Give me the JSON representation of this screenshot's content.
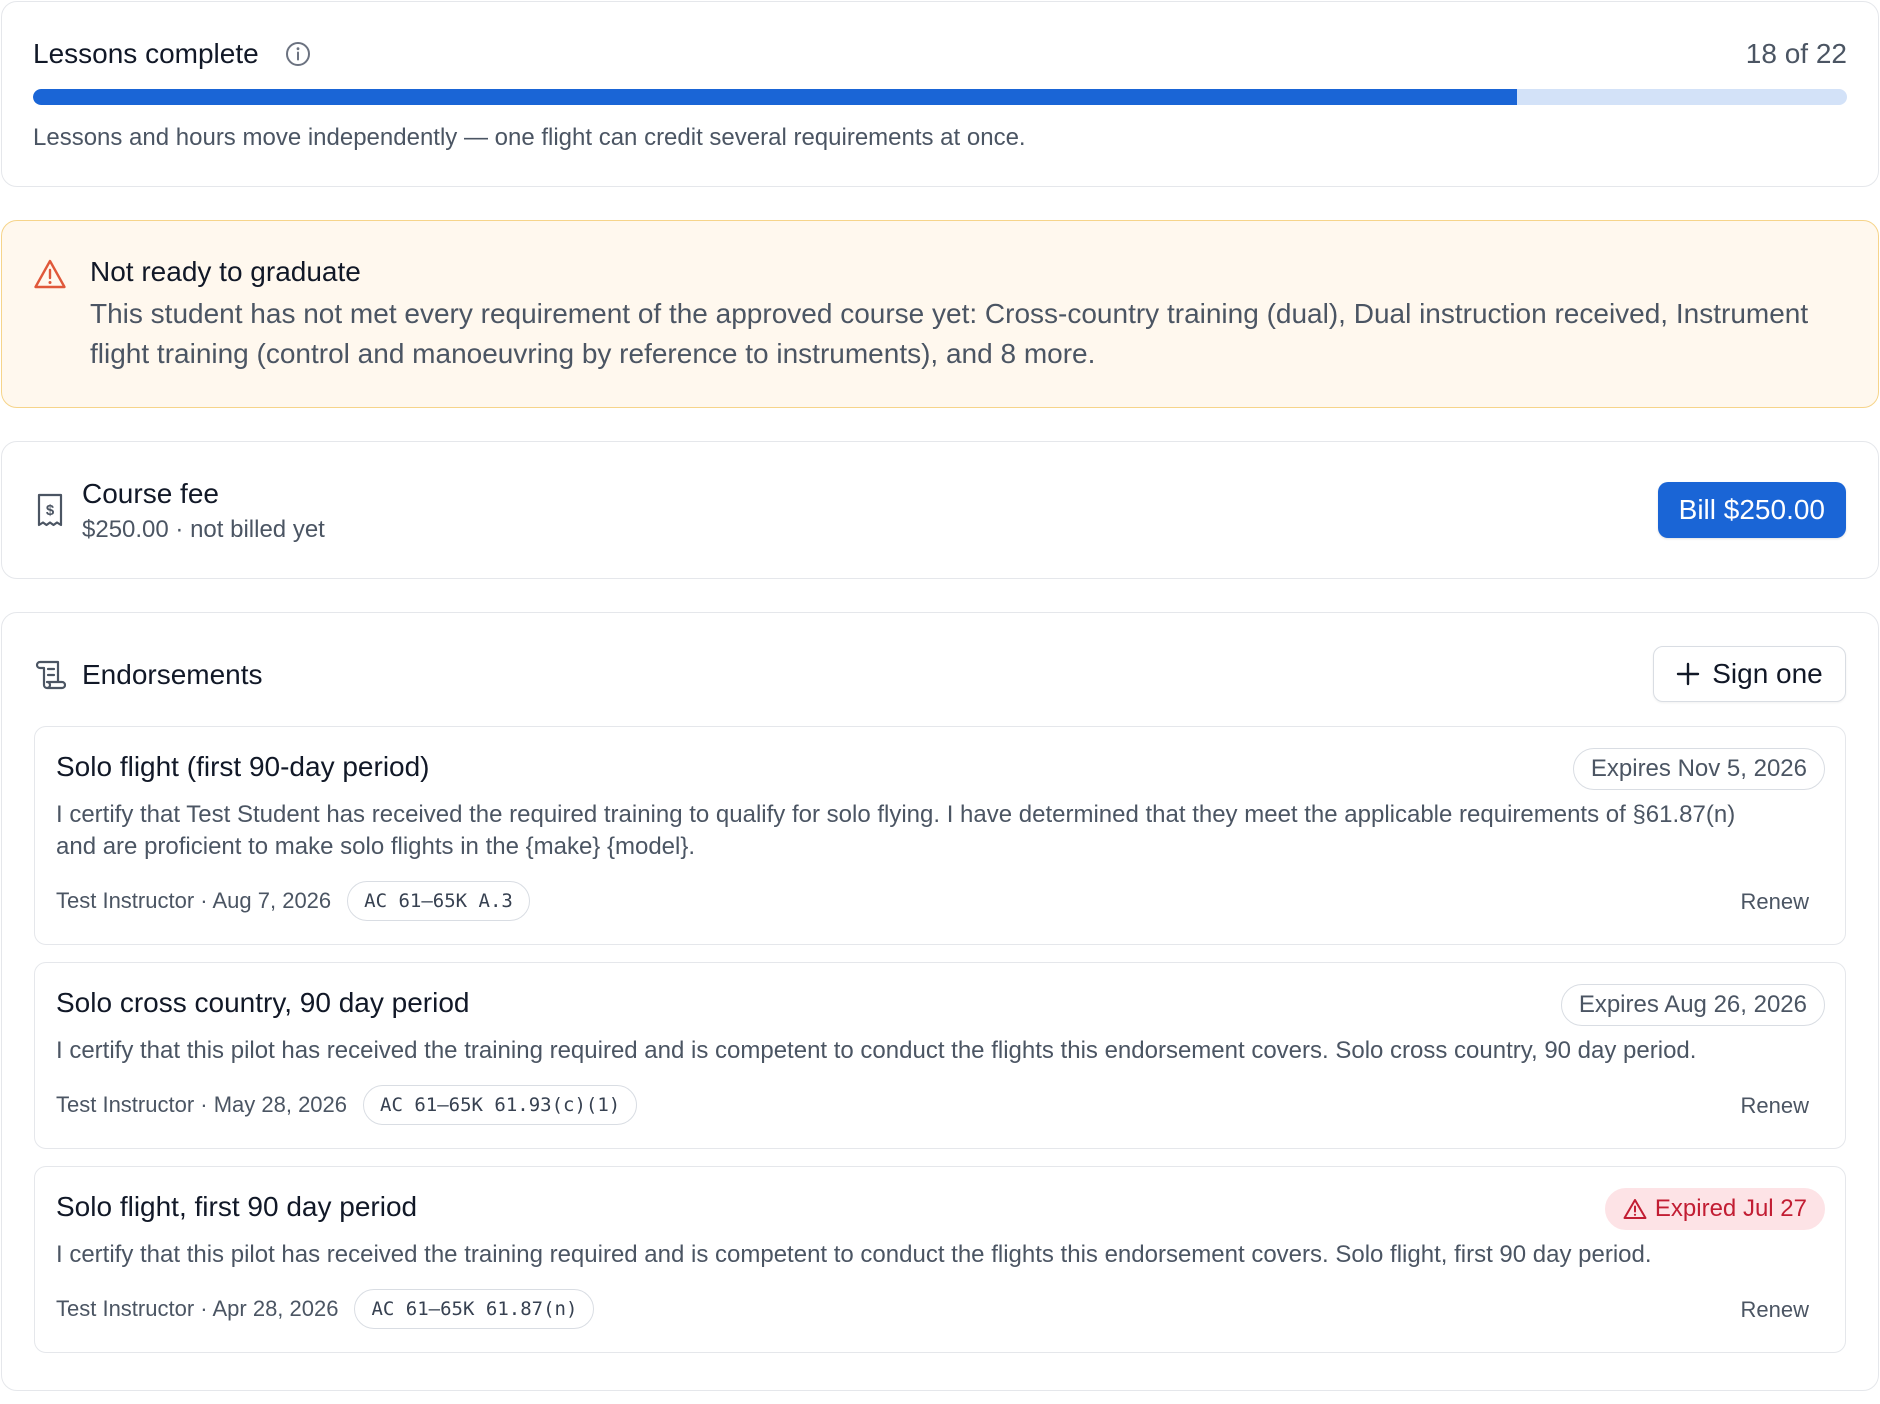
{
  "lessons": {
    "title": "Lessons complete",
    "count_text": "18 of 22",
    "completed": 18,
    "total": 22,
    "note": "Lessons and hours move independently — one flight can credit several requirements at once."
  },
  "warning": {
    "title": "Not ready to graduate",
    "body": "This student has not met every requirement of the approved course yet: Cross-country training (dual), Dual instruction received, Instrument flight training (control and manoeuvring by reference to instruments), and 8 more."
  },
  "fee": {
    "title": "Course fee",
    "subtitle": "$250.00 · not billed yet",
    "button_label": "Bill $250.00"
  },
  "endorsements": {
    "title": "Endorsements",
    "sign_label": "Sign one",
    "items": [
      {
        "title": "Solo flight (first 90-day period)",
        "badge": "Expires Nov 5, 2026",
        "expired": false,
        "body": "I certify that Test Student has received the required training to qualify for solo flying. I have determined that they meet the applicable requirements of §61.87(n) and are proficient to make solo flights in the {make} {model}.",
        "meta": "Test Instructor · Aug 7, 2026",
        "ref": "AC 61–65K A.3",
        "action": "Renew"
      },
      {
        "title": "Solo cross country, 90 day period",
        "badge": "Expires Aug 26, 2026",
        "expired": false,
        "body": "I certify that this pilot has received the training required and is competent to conduct the flights this endorsement covers. Solo cross country, 90 day period.",
        "meta": "Test Instructor · May 28, 2026",
        "ref": "AC 61–65K 61.93(c)(1)",
        "action": "Renew"
      },
      {
        "title": "Solo flight, first 90 day period",
        "badge": "Expired Jul 27",
        "expired": true,
        "body": "I certify that this pilot has received the training required and is competent to conduct the flights this endorsement covers. Solo flight, first 90 day period.",
        "meta": "Test Instructor · Apr 28, 2026",
        "ref": "AC 61–65K 61.87(n)",
        "action": "Renew"
      }
    ]
  },
  "colors": {
    "accent": "#1a65d6",
    "progress_track": "#d3e2f8",
    "warning_bg": "#fff8ee",
    "warning_icon": "#e0583a",
    "expired_bg": "#fde3e6",
    "expired_text": "#c21d33"
  },
  "icons": {
    "lessons_info": "info-icon",
    "warning": "warning-triangle-icon",
    "fee": "receipt-dollar-icon",
    "endorsements": "scroll-icon",
    "sign": "plus-icon",
    "expired": "warning-triangle-icon"
  }
}
